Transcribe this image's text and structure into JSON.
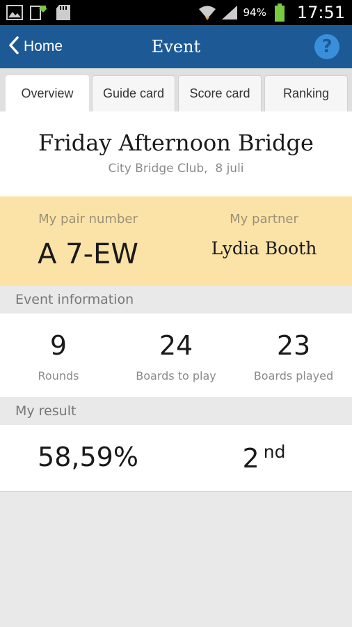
{
  "status_bar": {
    "battery": "94%",
    "time": "17:51",
    "icons": [
      "gallery-icon",
      "download-icon",
      "sd-card-icon",
      "wifi-icon",
      "signal-icon",
      "battery-icon"
    ]
  },
  "action_bar": {
    "back_label": "Home",
    "title": "Event",
    "help_glyph": "?"
  },
  "tabs": [
    {
      "label": "Overview",
      "active": true
    },
    {
      "label": "Guide card",
      "active": false
    },
    {
      "label": "Score card",
      "active": false
    },
    {
      "label": "Ranking",
      "active": false
    }
  ],
  "event": {
    "title": "Friday Afternoon Bridge",
    "subtitle": "City Bridge Club,  8 juli"
  },
  "pair": {
    "number_label": "My pair number",
    "number_value": "A 7-EW",
    "partner_label": "My partner",
    "partner_value": "Lydia Booth"
  },
  "event_info": {
    "header": "Event information",
    "stats": [
      {
        "value": "9",
        "label": "Rounds"
      },
      {
        "value": "24",
        "label": "Boards to play"
      },
      {
        "value": "23",
        "label": "Boards played"
      }
    ]
  },
  "result": {
    "header": "My result",
    "percentage": "58,59%",
    "rank": "2",
    "rank_suffix": "nd"
  },
  "colors": {
    "action_bar": "#1d5a95",
    "help_circle": "#3a8fdb",
    "pair_panel": "#fbe2a7",
    "background": "#e9e9e9"
  }
}
